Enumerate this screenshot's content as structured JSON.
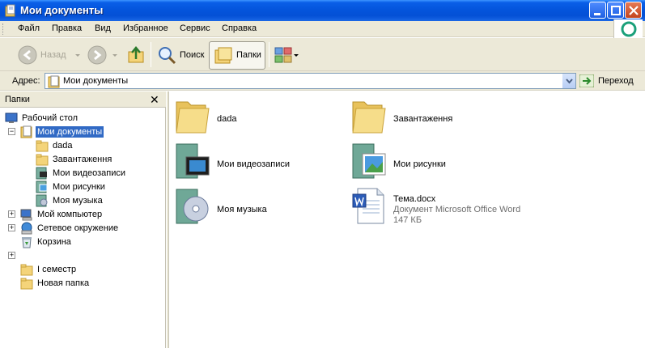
{
  "window": {
    "title": "Мои документы"
  },
  "menu": [
    "Файл",
    "Правка",
    "Вид",
    "Избранное",
    "Сервис",
    "Справка"
  ],
  "toolbar": {
    "back_label": "Назад",
    "search_label": "Поиск",
    "folders_label": "Папки"
  },
  "address": {
    "label": "Адрес:",
    "value": "Мои документы",
    "go_label": "Переход"
  },
  "folders_pane": {
    "title": "Папки",
    "close_glyph": "✕",
    "tree": [
      {
        "label": "Рабочий стол"
      },
      {
        "label": "Мои документы",
        "selected": true,
        "expander": "−"
      },
      {
        "label": "dada"
      },
      {
        "label": "Завантаження"
      },
      {
        "label": "Мои видеозаписи"
      },
      {
        "label": "Мои рисунки"
      },
      {
        "label": "Моя музыка"
      },
      {
        "label": "Мой компьютер",
        "expander": "+"
      },
      {
        "label": "Сетевое окружение",
        "expander": "+"
      },
      {
        "label": "Корзина"
      },
      {
        "label": "",
        "expander": "+"
      },
      {
        "label": "I семестр"
      },
      {
        "label": "Новая папка"
      }
    ]
  },
  "content": {
    "items": [
      {
        "name": "dada",
        "icon": "folder-icon"
      },
      {
        "name": "Завантаження",
        "icon": "folder-icon"
      },
      {
        "name": "Мои видеозаписи",
        "icon": "video-folder-icon"
      },
      {
        "name": "Мои рисунки",
        "icon": "pictures-folder-icon"
      },
      {
        "name": "Моя музыка",
        "icon": "music-folder-icon"
      },
      {
        "name": "Тема.docx",
        "icon": "word-document-icon",
        "type": "Документ Microsoft Office Word",
        "size": "147 КБ"
      }
    ]
  },
  "colors": {
    "titlebar": "#0455dc",
    "selection": "#316ac5",
    "chrome": "#ece9d8",
    "folder": "#f4d47a"
  }
}
